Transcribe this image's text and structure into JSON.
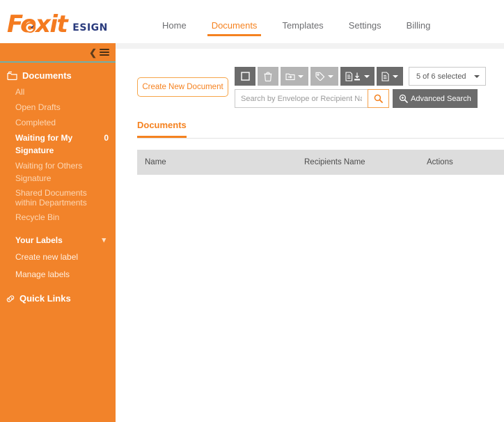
{
  "brand": {
    "logo_text": "Foxit",
    "product": "ESIGN",
    "accent_color": "#f58220",
    "sidebar_color": "#f2832a",
    "rule_color": "#6fb0ab"
  },
  "nav": {
    "items": [
      {
        "label": "Home",
        "active": false
      },
      {
        "label": "Documents",
        "active": true
      },
      {
        "label": "Templates",
        "active": false
      },
      {
        "label": "Settings",
        "active": false
      },
      {
        "label": "Billing",
        "active": false
      }
    ]
  },
  "sidebar": {
    "collapse_icon": "chevron-left-icon",
    "menu_icon": "hamburger-icon",
    "section": {
      "icon": "folder-icon",
      "title": "Documents"
    },
    "items": [
      {
        "label": "All",
        "count": "",
        "active": false
      },
      {
        "label": "Open Drafts",
        "count": "",
        "active": false
      },
      {
        "label": "Completed",
        "count": "",
        "active": false
      },
      {
        "label": "Waiting for My Signature",
        "count": "0",
        "active": true
      },
      {
        "label": "Waiting for Others Signature",
        "count": "",
        "active": false
      },
      {
        "label": "Shared Documents within Departments",
        "count": "",
        "active": false
      },
      {
        "label": "Recycle Bin",
        "count": "",
        "active": false
      }
    ],
    "labels_group": {
      "title": "Your Labels",
      "chevron": "chevron-down-icon",
      "items": [
        {
          "label": "Create new label"
        },
        {
          "label": "Manage labels"
        }
      ]
    },
    "quick_links": {
      "icon": "link-icon",
      "label": "Quick Links"
    }
  },
  "main": {
    "create_button": "Create New Document",
    "toolbar": {
      "buttons": [
        {
          "name": "select-all-checkbox-button",
          "icon": "square-icon",
          "style": "dark",
          "caret": false
        },
        {
          "name": "delete-button",
          "icon": "trash-icon",
          "style": "light",
          "caret": false
        },
        {
          "name": "move-to-folder-button",
          "icon": "folder-move-icon",
          "style": "light",
          "caret": true
        },
        {
          "name": "apply-label-button",
          "icon": "tag-icon",
          "style": "light",
          "caret": true
        },
        {
          "name": "download-signed-button",
          "icon": "document-download-icon",
          "style": "dark",
          "caret": true
        },
        {
          "name": "export-document-button",
          "icon": "document-icon",
          "style": "dark",
          "caret": true
        }
      ],
      "selection_dropdown": "5 of 6 selected"
    },
    "search": {
      "placeholder": "Search by Envelope or Recipient Name",
      "value": "",
      "search_icon": "magnifier-icon",
      "advanced_label": "Advanced Search",
      "advanced_icon": "magnifier-plus-icon"
    },
    "content_tab": "Documents",
    "table": {
      "columns": [
        "Name",
        "Recipients Name",
        "Actions"
      ],
      "rows": []
    }
  }
}
